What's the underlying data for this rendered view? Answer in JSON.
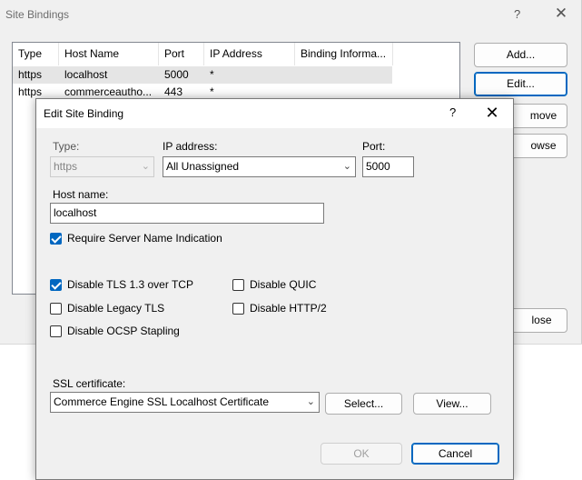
{
  "site_bindings": {
    "title": "Site Bindings",
    "help_glyph": "?",
    "close_glyph": "✕",
    "columns": [
      "Type",
      "Host Name",
      "Port",
      "IP Address",
      "Binding Informa..."
    ],
    "rows": [
      {
        "type": "https",
        "host": "localhost",
        "port": "5000",
        "ip": "*",
        "info": ""
      },
      {
        "type": "https",
        "host": "commerceautho...",
        "port": "443",
        "ip": "*",
        "info": ""
      }
    ],
    "buttons": {
      "add": "Add...",
      "edit": "Edit...",
      "remove_partial": "move",
      "browse_partial": "owse",
      "close_partial": "lose"
    }
  },
  "edit_dialog": {
    "title": "Edit Site Binding",
    "help_glyph": "?",
    "close_glyph": "✕",
    "type_label": "Type:",
    "type_value": "https",
    "ip_label": "IP address:",
    "ip_value": "All Unassigned",
    "port_label": "Port:",
    "port_value": "5000",
    "host_label": "Host name:",
    "host_value": "localhost",
    "checkboxes": {
      "sni": {
        "label": "Require Server Name Indication",
        "checked": true
      },
      "tls13": {
        "label": "Disable TLS 1.3 over TCP",
        "checked": true
      },
      "quic": {
        "label": "Disable QUIC",
        "checked": false
      },
      "legacy_tls": {
        "label": "Disable Legacy TLS",
        "checked": false
      },
      "http2": {
        "label": "Disable HTTP/2",
        "checked": false
      },
      "ocsp": {
        "label": "Disable OCSP Stapling",
        "checked": false
      }
    },
    "ssl_label": "SSL certificate:",
    "ssl_value": "Commerce Engine SSL Localhost Certificate",
    "select_button": "Select...",
    "view_button": "View...",
    "ok_button": "OK",
    "cancel_button": "Cancel"
  },
  "colors": {
    "accent": "#0067c0",
    "dialog_bg": "#f0f0f0",
    "selected_row": "#e5e5e5"
  }
}
